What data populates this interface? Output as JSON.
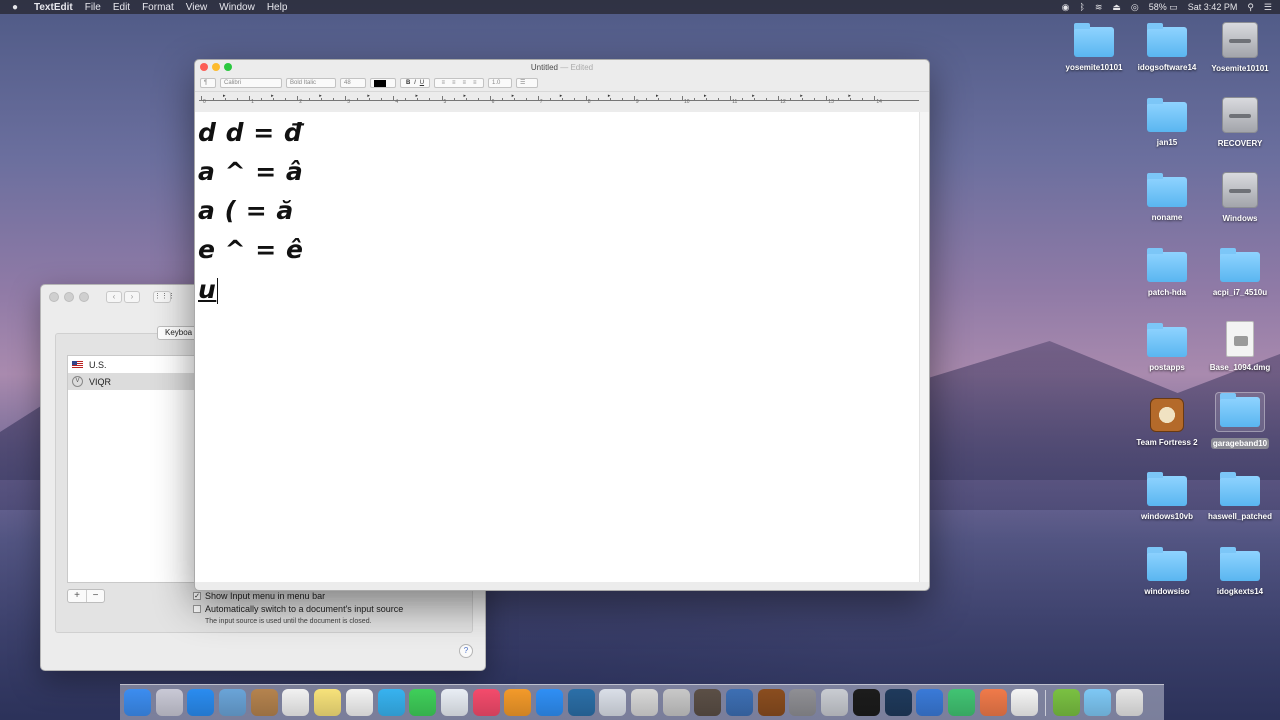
{
  "menubar": {
    "app": "TextEdit",
    "items": [
      "File",
      "Edit",
      "Format",
      "View",
      "Window",
      "Help"
    ],
    "battery": "58%",
    "clock": "Sat 3:42 PM"
  },
  "desktop_icons": [
    {
      "label": "yosemite10101",
      "kind": "folder"
    },
    {
      "label": "idogsoftware14",
      "kind": "folder"
    },
    {
      "label": "Yosemite10101",
      "kind": "drive"
    },
    {
      "label": "jan15",
      "kind": "folder"
    },
    {
      "label": "RECOVERY",
      "kind": "drive"
    },
    {
      "label": "noname",
      "kind": "folder"
    },
    {
      "label": "Windows",
      "kind": "drive"
    },
    {
      "label": "patch-hda",
      "kind": "folder"
    },
    {
      "label": "acpi_i7_4510u",
      "kind": "folder"
    },
    {
      "label": "postapps",
      "kind": "folder"
    },
    {
      "label": "Base_1094.dmg",
      "kind": "dmg"
    },
    {
      "label": "Team Fortress 2",
      "kind": "tf2"
    },
    {
      "label": "garageband10",
      "kind": "folder"
    },
    {
      "label": "windows10vb",
      "kind": "folder"
    },
    {
      "label": "haswell_patched",
      "kind": "folder"
    },
    {
      "label": "windowsiso",
      "kind": "folder"
    },
    {
      "label": "idogkexts14",
      "kind": "folder"
    }
  ],
  "prefs": {
    "tab_stub": "Keyboa",
    "sources": [
      "U.S.",
      "VIQR"
    ],
    "add": "+",
    "remove": "−",
    "show_input_menu": "Show Input menu in menu bar",
    "auto_switch": "Automatically switch to a document's input source",
    "note": "The input source is used until the document is closed.",
    "help": "?"
  },
  "textedit": {
    "title": "Untitled",
    "edited": "— Edited",
    "toolbar": {
      "paragraph": "¶",
      "font": "Calibri",
      "style": "Bold Italic",
      "size": "48",
      "bold": "B",
      "italic": "I",
      "underline": "U",
      "spacing": "1.0"
    },
    "ruler_numbers": [
      "0",
      "1",
      "2",
      "3",
      "4",
      "5",
      "6",
      "7",
      "8",
      "9",
      "10",
      "11",
      "12",
      "13",
      "14"
    ],
    "lines": [
      "d d = đ",
      "a ^ = â",
      "a ( = ă",
      "e ^ = ê"
    ],
    "current_line": "u"
  },
  "colors": {
    "accent": "#5ab6f0",
    "close": "#fc5f57",
    "minimize": "#fdbb2e",
    "zoom": "#2bc840"
  },
  "dock_apps": [
    "Finder",
    "Launchpad",
    "Safari",
    "Mail",
    "Contacts",
    "Calendar",
    "Notes",
    "Reminders",
    "Messages",
    "FaceTime",
    "Preview",
    "iTunes",
    "iBooks",
    "App Store",
    "QuickTime",
    "Xcode",
    "Automator",
    "Script Editor",
    "iMovie",
    "VirtualBox",
    "Team Fortress 2",
    "System Preferences",
    "Image Capture",
    "Terminal",
    "Activity Monitor",
    "Word",
    "Bullet",
    "Paw",
    "Paper",
    "Android",
    "Downloads",
    "Trash"
  ]
}
